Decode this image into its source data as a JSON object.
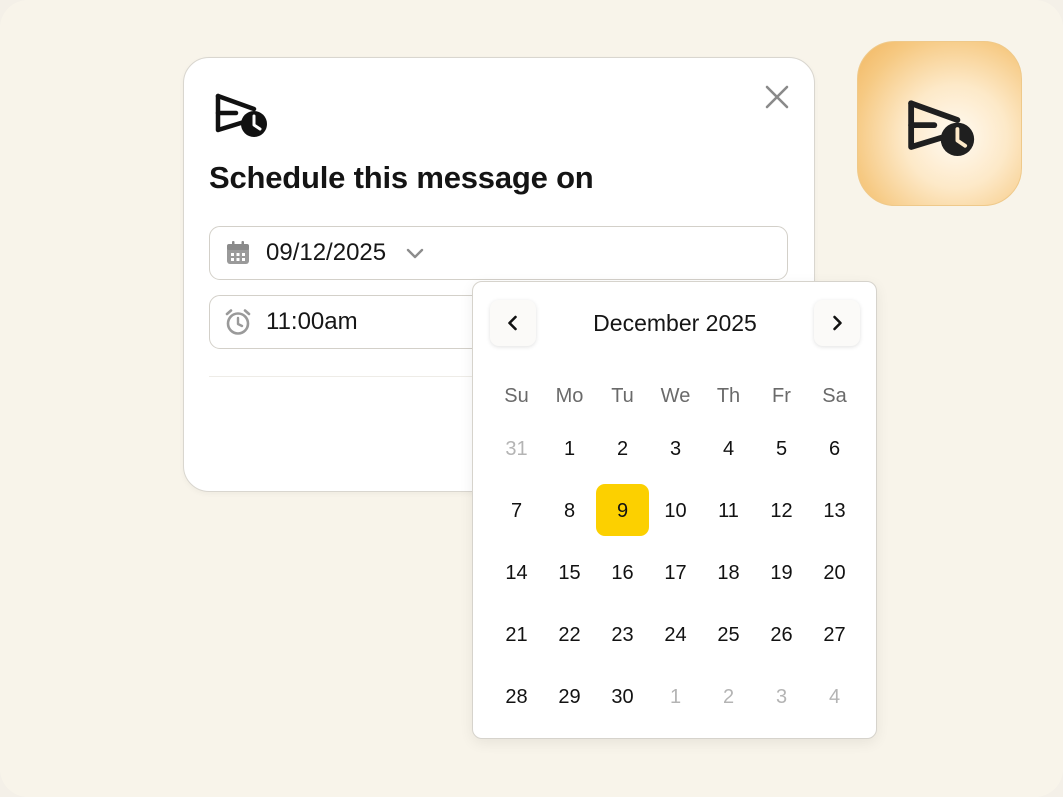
{
  "dialog": {
    "title": "Schedule this message on",
    "date_value": "09/12/2025",
    "time_value": "11:00am"
  },
  "calendar": {
    "month_label": "December 2025",
    "weekdays": [
      "Su",
      "Mo",
      "Tu",
      "We",
      "Th",
      "Fr",
      "Sa"
    ],
    "selected_day": "9",
    "accent_color": "#fcd000",
    "days": [
      {
        "label": "31",
        "muted": true
      },
      {
        "label": "1",
        "muted": false
      },
      {
        "label": "2",
        "muted": false
      },
      {
        "label": "3",
        "muted": false
      },
      {
        "label": "4",
        "muted": false
      },
      {
        "label": "5",
        "muted": false
      },
      {
        "label": "6",
        "muted": false
      },
      {
        "label": "7",
        "muted": false
      },
      {
        "label": "8",
        "muted": false
      },
      {
        "label": "9",
        "muted": false,
        "selected": true
      },
      {
        "label": "10",
        "muted": false
      },
      {
        "label": "11",
        "muted": false
      },
      {
        "label": "12",
        "muted": false
      },
      {
        "label": "13",
        "muted": false
      },
      {
        "label": "14",
        "muted": false
      },
      {
        "label": "15",
        "muted": false
      },
      {
        "label": "16",
        "muted": false
      },
      {
        "label": "17",
        "muted": false
      },
      {
        "label": "18",
        "muted": false
      },
      {
        "label": "19",
        "muted": false
      },
      {
        "label": "20",
        "muted": false
      },
      {
        "label": "21",
        "muted": false
      },
      {
        "label": "22",
        "muted": false
      },
      {
        "label": "23",
        "muted": false
      },
      {
        "label": "24",
        "muted": false
      },
      {
        "label": "25",
        "muted": false
      },
      {
        "label": "26",
        "muted": false
      },
      {
        "label": "27",
        "muted": false
      },
      {
        "label": "28",
        "muted": false
      },
      {
        "label": "29",
        "muted": false
      },
      {
        "label": "30",
        "muted": false
      },
      {
        "label": "1",
        "muted": true
      },
      {
        "label": "2",
        "muted": true
      },
      {
        "label": "3",
        "muted": true
      },
      {
        "label": "4",
        "muted": true
      }
    ]
  },
  "icons": {
    "brand": "schedule-send-icon",
    "close": "close-icon",
    "date": "calendar-icon",
    "time": "alarm-clock-icon",
    "dropdown": "chevron-down-icon",
    "prev": "chevron-left-icon",
    "next": "chevron-right-icon"
  },
  "colors": {
    "background": "#f8f4ea",
    "tile_gradient_outer": "#f2b660",
    "selected_day": "#fcd000"
  }
}
